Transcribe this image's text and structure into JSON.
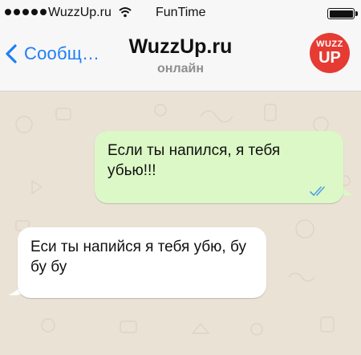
{
  "status_bar": {
    "carrier": "WuzzUp.ru",
    "time": "FunTime"
  },
  "nav": {
    "back_label": "Сообщ…",
    "title": "WuzzUp.ru",
    "status": "онлайн",
    "avatar_line1": "WUZZ",
    "avatar_line2": "UP"
  },
  "messages": [
    {
      "direction": "outgoing",
      "text": "Если ты напился, я тебя убью!!!",
      "read": true
    },
    {
      "direction": "incoming",
      "text": "Еси ты напийся я тебя убю, бу бу бу"
    }
  ],
  "colors": {
    "accent": "#1e7ff5",
    "outgoing_bubble": "#dcf8c6",
    "incoming_bubble": "#ffffff",
    "avatar": "#e53b33",
    "read_ticks": "#4fa3e0"
  }
}
